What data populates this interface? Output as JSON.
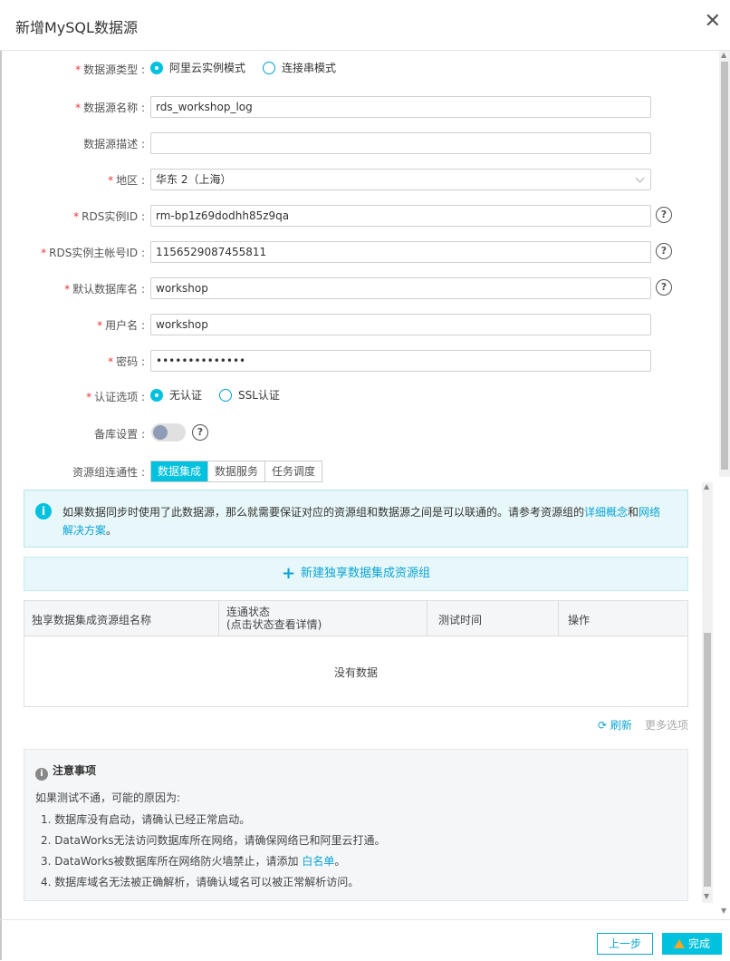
{
  "dialog": {
    "title": "新增MySQL数据源",
    "close": "✕"
  },
  "form": {
    "source_type": {
      "label": "数据源类型 :",
      "options": [
        "阿里云实例模式",
        "连接串模式"
      ],
      "selected": 0
    },
    "name": {
      "label": "数据源名称 :",
      "value": "rds_workshop_log"
    },
    "desc": {
      "label": "数据源描述 :",
      "value": ""
    },
    "region": {
      "label": "地区 :",
      "value": "华东 2（上海）"
    },
    "rds_id": {
      "label": "RDS实例ID :",
      "value": "rm-bp1z69dodhh85z9qa"
    },
    "rds_account": {
      "label": "RDS实例主帐号ID :",
      "value": "1156529087455811"
    },
    "db_name": {
      "label": "默认数据库名 :",
      "value": "workshop"
    },
    "user": {
      "label": "用户名 :",
      "value": "workshop"
    },
    "password": {
      "label": "密码 :",
      "value": "••••••••••••••"
    },
    "auth": {
      "label": "认证选项 :",
      "options": [
        "无认证",
        "SSL认证"
      ],
      "selected": 0
    },
    "backup": {
      "label": "备库设置 :",
      "enabled": false
    },
    "connectivity": {
      "label": "资源组连通性 :",
      "tabs": [
        "数据集成",
        "数据服务",
        "任务调度"
      ],
      "active": 0
    }
  },
  "notice": {
    "text": "如果数据同步时使用了此数据源，那么就需要保证对应的资源组和数据源之间是可以联通的。请参考资源组的",
    "link1": "详细概念",
    "and": "和",
    "link2": "网络解决方案",
    "end": "。"
  },
  "new_group_button": "新建独享数据集成资源组",
  "table": {
    "headers": [
      "独享数据集成资源组名称",
      "连通状态",
      "(点击状态查看详情)",
      "测试时间",
      "操作"
    ],
    "empty": "没有数据"
  },
  "actions": {
    "refresh": "刷新",
    "more": "更多选项"
  },
  "notes": {
    "title": "注意事项",
    "subtitle": "如果测试不通，可能的原因为:",
    "items": [
      "1.  数据库没有启动，请确认已经正常启动。",
      "2.  DataWorks无法访问数据库所在网络，请确保网络已和阿里云打通。",
      "3.  DataWorks被数据库所在网络防火墙禁止，请添加 ",
      "4.  数据库域名无法被正确解析，请确认域名可以被正常解析访问。"
    ],
    "whitelist": "白名单",
    "period": "。"
  },
  "footer": {
    "prev": "上一步",
    "done": "完成"
  },
  "colors": {
    "accent": "#00c1de",
    "link": "#0aa5d5",
    "required": "#e5383b"
  }
}
